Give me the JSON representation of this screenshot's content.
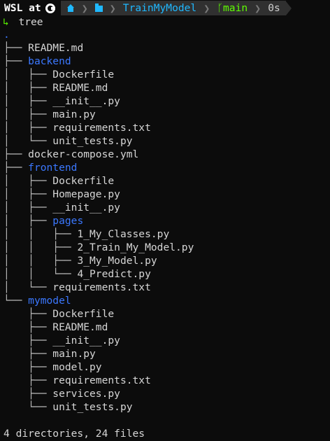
{
  "prompt": {
    "os_label": "WSL at",
    "path_root_icon": "home-icon",
    "path_folder_icon": "folder-icon",
    "path_folder": "TrainMyModel",
    "branch_icon": "git-branch-icon",
    "branch": "main",
    "duration": "0s",
    "command_arrow": "↳",
    "command": "tree"
  },
  "tree": {
    "root": ".",
    "rows": [
      {
        "prefix": "├── ",
        "name": "README.md",
        "type": "file"
      },
      {
        "prefix": "├── ",
        "name": "backend",
        "type": "dir"
      },
      {
        "prefix": "│   ├── ",
        "name": "Dockerfile",
        "type": "file"
      },
      {
        "prefix": "│   ├── ",
        "name": "README.md",
        "type": "file"
      },
      {
        "prefix": "│   ├── ",
        "name": "__init__.py",
        "type": "file"
      },
      {
        "prefix": "│   ├── ",
        "name": "main.py",
        "type": "file"
      },
      {
        "prefix": "│   ├── ",
        "name": "requirements.txt",
        "type": "file"
      },
      {
        "prefix": "│   └── ",
        "name": "unit_tests.py",
        "type": "file"
      },
      {
        "prefix": "├── ",
        "name": "docker-compose.yml",
        "type": "file"
      },
      {
        "prefix": "├── ",
        "name": "frontend",
        "type": "dir"
      },
      {
        "prefix": "│   ├── ",
        "name": "Dockerfile",
        "type": "file"
      },
      {
        "prefix": "│   ├── ",
        "name": "Homepage.py",
        "type": "file"
      },
      {
        "prefix": "│   ├── ",
        "name": "__init__.py",
        "type": "file"
      },
      {
        "prefix": "│   ├── ",
        "name": "pages",
        "type": "dir"
      },
      {
        "prefix": "│   │   ├── ",
        "name": "1_My_Classes.py",
        "type": "file"
      },
      {
        "prefix": "│   │   ├── ",
        "name": "2_Train_My_Model.py",
        "type": "file"
      },
      {
        "prefix": "│   │   ├── ",
        "name": "3_My_Model.py",
        "type": "file"
      },
      {
        "prefix": "│   │   └── ",
        "name": "4_Predict.py",
        "type": "file"
      },
      {
        "prefix": "│   └── ",
        "name": "requirements.txt",
        "type": "file"
      },
      {
        "prefix": "└── ",
        "name": "mymodel",
        "type": "dir"
      },
      {
        "prefix": "    ├── ",
        "name": "Dockerfile",
        "type": "file"
      },
      {
        "prefix": "    ├── ",
        "name": "README.md",
        "type": "file"
      },
      {
        "prefix": "    ├── ",
        "name": "__init__.py",
        "type": "file"
      },
      {
        "prefix": "    ├── ",
        "name": "main.py",
        "type": "file"
      },
      {
        "prefix": "    ├── ",
        "name": "model.py",
        "type": "file"
      },
      {
        "prefix": "    ├── ",
        "name": "requirements.txt",
        "type": "file"
      },
      {
        "prefix": "    ├── ",
        "name": "services.py",
        "type": "file"
      },
      {
        "prefix": "    └── ",
        "name": "unit_tests.py",
        "type": "file"
      }
    ]
  },
  "summary": "4 directories, 24 files",
  "colors": {
    "background": "#0c0c0c",
    "directory": "#3b78ff",
    "path": "#1fb8ff",
    "branch": "#5fff00",
    "segment_bg": "#303030"
  }
}
